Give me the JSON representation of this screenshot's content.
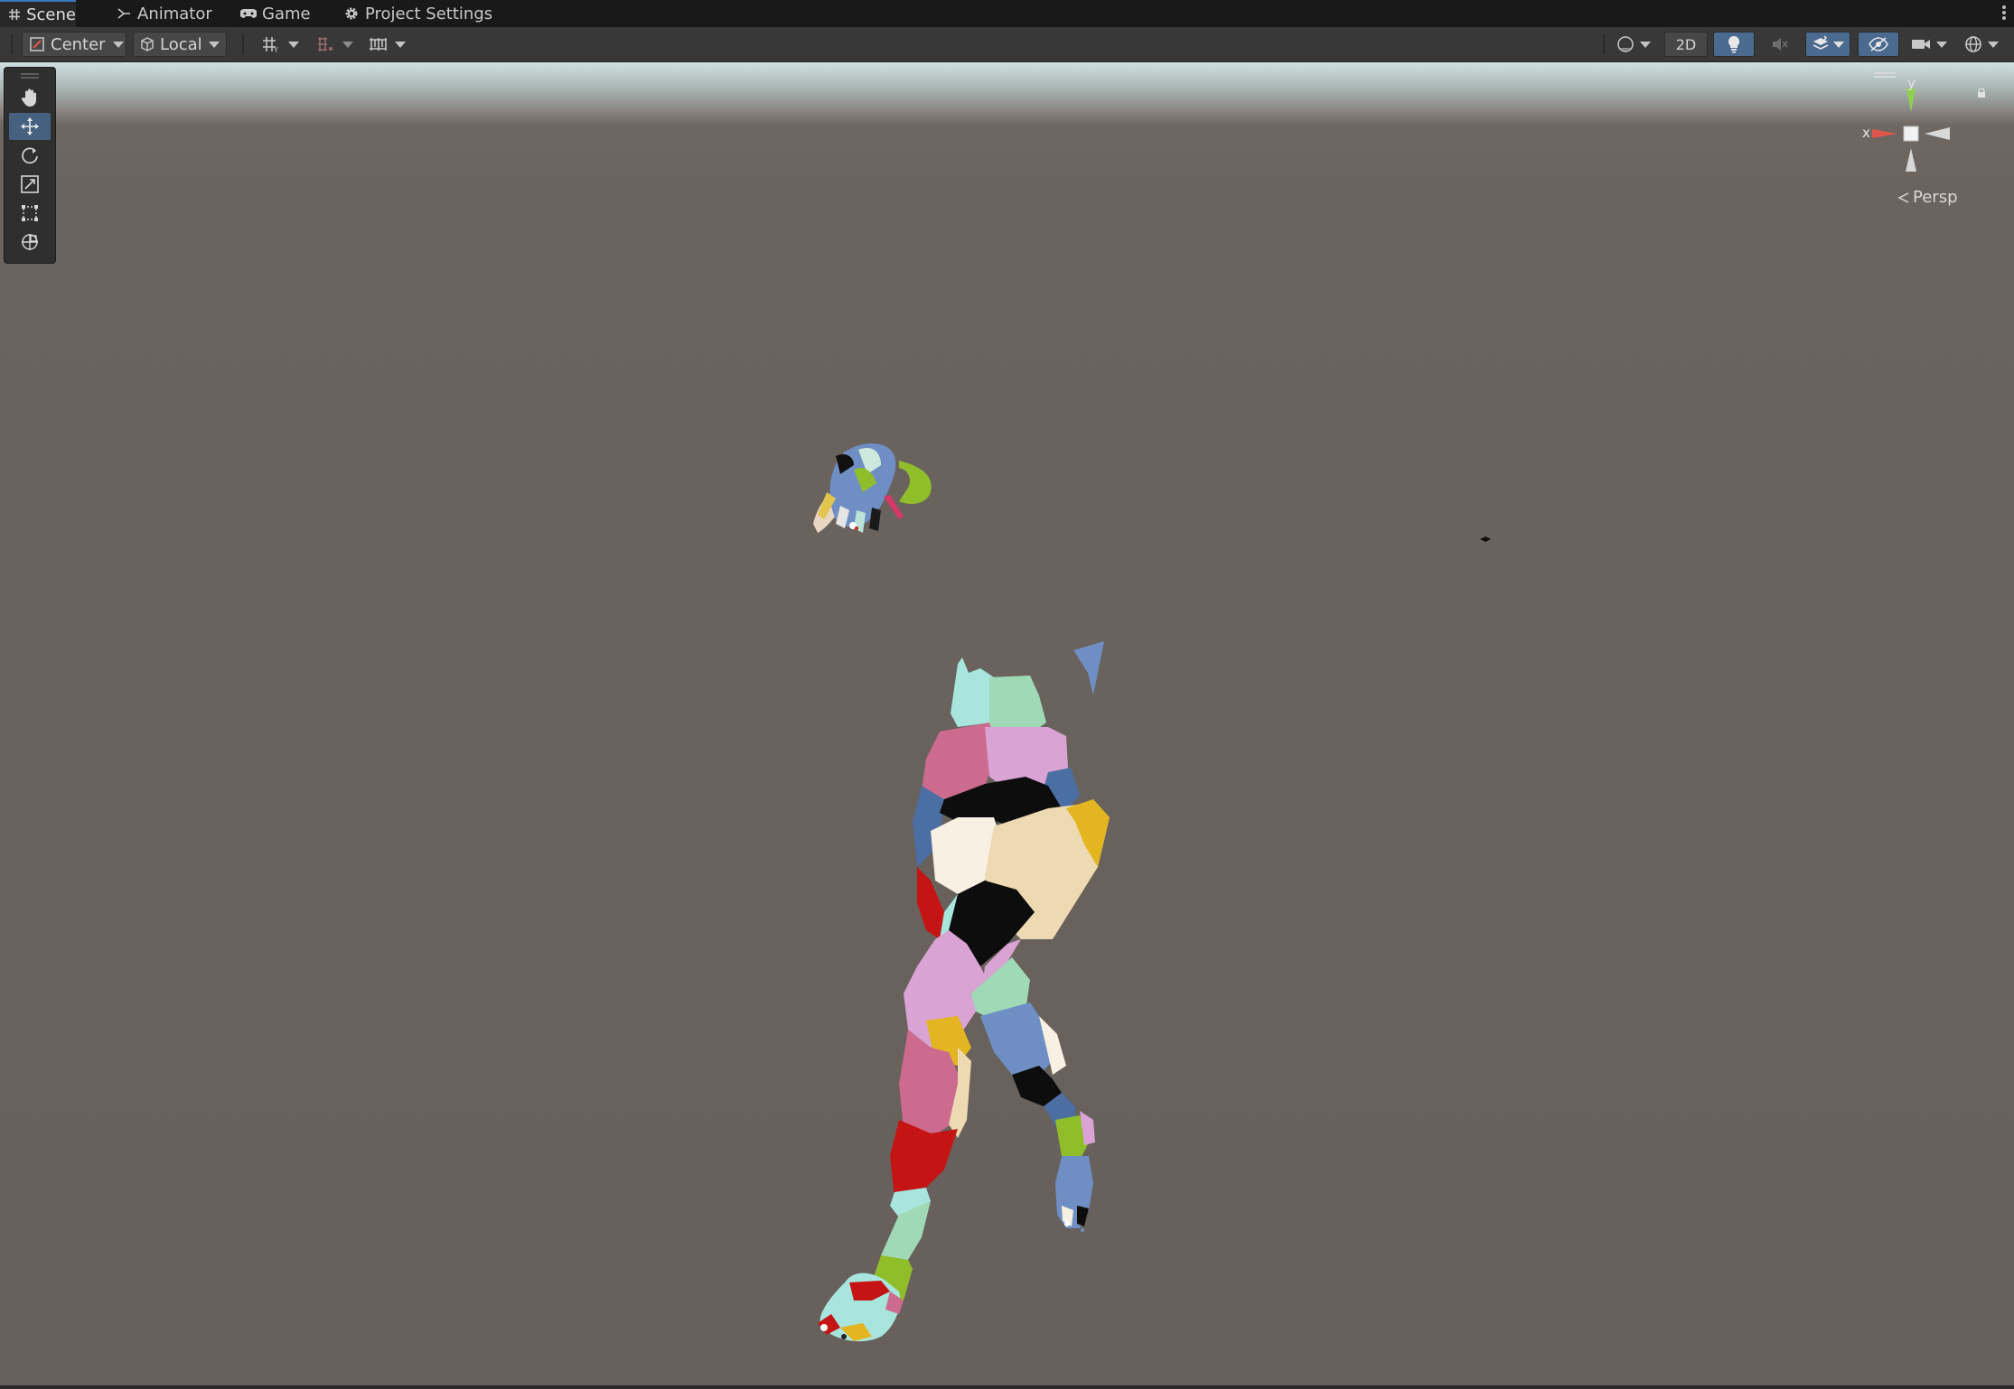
{
  "tabs": [
    {
      "label": "Scene",
      "icon": "grid-icon",
      "active": true
    },
    {
      "label": "Animator",
      "icon": "animator-icon",
      "active": false
    },
    {
      "label": "Game",
      "icon": "gamepad-icon",
      "active": false
    },
    {
      "label": "Project Settings",
      "icon": "gear-icon",
      "active": false
    }
  ],
  "toolbar": {
    "pivot_label": "Center",
    "space_label": "Local",
    "mode_2d_label": "2D"
  },
  "viewport": {
    "projection_label": "Persp",
    "axis_x": "x",
    "axis_y": "y"
  },
  "colors": {
    "accent": "#3a79bb",
    "toggle_on": "#4a6a8f",
    "scene_bg": "#67605b",
    "sky": "#cfe0e1",
    "axis_x": "#e0554a",
    "axis_y": "#8fd14f"
  },
  "tools": [
    "hand-tool-icon",
    "move-tool-icon",
    "rotate-tool-icon",
    "scale-tool-icon",
    "rect-tool-icon",
    "transform-tool-icon"
  ]
}
